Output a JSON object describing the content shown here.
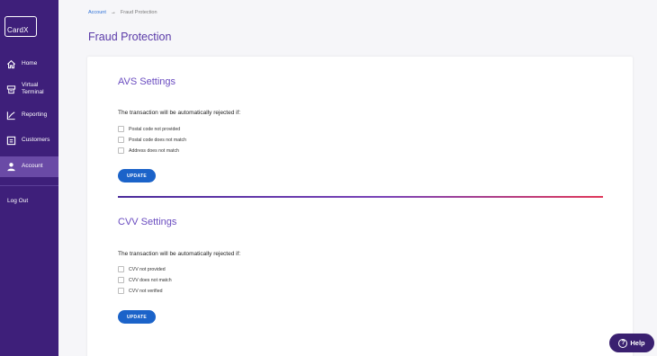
{
  "app": {
    "logo_text": "CardX"
  },
  "sidebar": {
    "items": [
      {
        "label": "Home",
        "icon": "home-icon"
      },
      {
        "label": "Virtual Terminal",
        "icon": "terminal-icon"
      },
      {
        "label": "Reporting",
        "icon": "chart-icon"
      },
      {
        "label": "Customers",
        "icon": "id-card-icon"
      },
      {
        "label": "Account",
        "icon": "user-icon",
        "active": true
      }
    ],
    "logout_label": "Log Out"
  },
  "breadcrumb": {
    "parent": "Account",
    "separator": "→",
    "current": "Fraud Protection"
  },
  "page": {
    "title": "Fraud Protection"
  },
  "avs": {
    "title": "AVS Settings",
    "description": "The transaction will be automatically rejected if:",
    "options": [
      "Postal code not provided",
      "Postal code does not match",
      "Address does not match"
    ],
    "button": "UPDATE"
  },
  "cvv": {
    "title": "CVV Settings",
    "description": "The transaction will be automatically rejected if:",
    "options": [
      "CVV not provided",
      "CVV does not match",
      "CVV not verified"
    ],
    "button": "UPDATE"
  },
  "help": {
    "label": "Help",
    "icon_glyph": "?"
  },
  "colors": {
    "sidebar": "#3e1f7a",
    "accent": "#6a4cc0",
    "button": "#1b63c9"
  }
}
